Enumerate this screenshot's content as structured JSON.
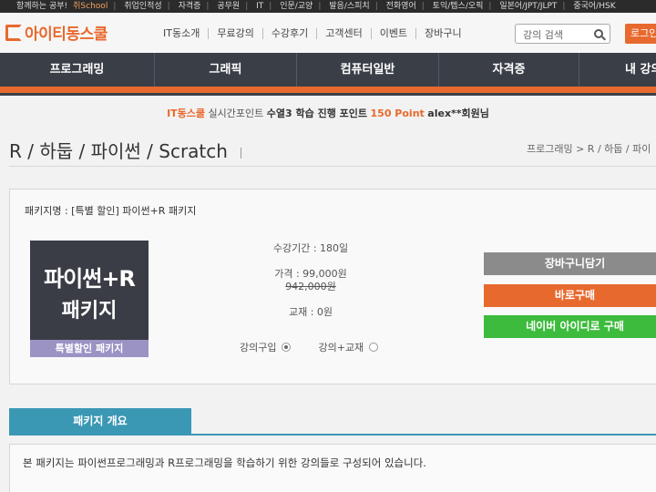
{
  "topbar": {
    "items": [
      "함께하는 공부!",
      "취업인적성",
      "자격증",
      "공무원",
      "IT",
      "인문/교양",
      "발음/스피치",
      "전화영어",
      "토익/텝스/오픽",
      "일본어/JPT/JLPT",
      "중국어/HSK"
    ],
    "highlight": "쥐School"
  },
  "header": {
    "logo": "아이티동스쿨",
    "menu": [
      "IT동소개",
      "무료강의",
      "수강후기",
      "고객센터",
      "이벤트",
      "장바구니"
    ],
    "search_placeholder": "강의 검색",
    "login_label": "로그인"
  },
  "category_nav": [
    "프로그래밍",
    "그래픽",
    "컴퓨터일반",
    "자격증",
    "내 강의"
  ],
  "notice": {
    "brand": "IT동스쿨",
    "text1": "실시간포인트",
    "text2": "수열3 학습 진행 포인트",
    "points": "150 Point",
    "member": "alex**회원님"
  },
  "page": {
    "title": "R / 하둡 / 파이썬 / Scratch",
    "breadcrumb": "프로그래밍 > R / 하둡 / 파이"
  },
  "product": {
    "package_name": "패키지명 : [특별 할인] 파이썬+R 패키지",
    "thumb_line1": "파이썬+R",
    "thumb_line2": "패키지",
    "thumb_badge": "특별할인 패키지",
    "period": "수강기간 : 180일",
    "price": "가격 : 99,000원",
    "original_price": "942,000원",
    "material": "교재 : 0원",
    "option1": "강의구입",
    "option2": "강의+교재",
    "cart_button": "장바구니담기",
    "buy_button": "바로구매",
    "naver_button": "네이버 아이디로 구매"
  },
  "overview": {
    "tab_label": "패키지 개요",
    "description": "본 패키지는 파이썬프로그래밍과 R프로그래밍을 학습하기 위한 강의들로 구성되어 있습니다."
  },
  "colors": {
    "accent": "#e8692e",
    "nav_bg": "#3a3e47",
    "tab_blue": "#3b98b5",
    "naver_green": "#3dbb3d"
  }
}
